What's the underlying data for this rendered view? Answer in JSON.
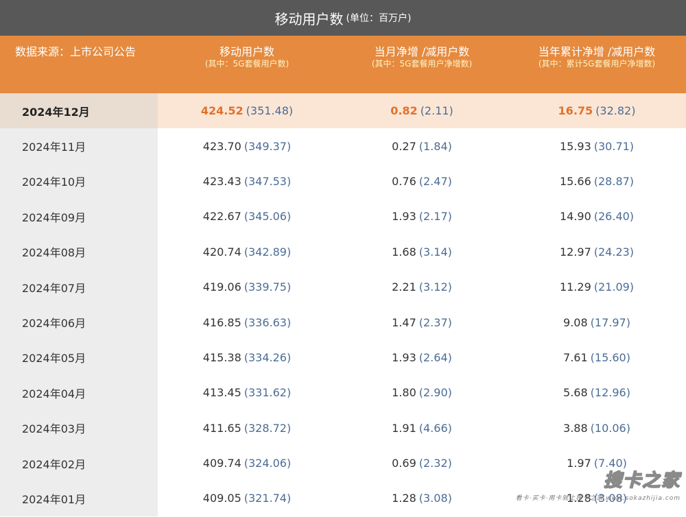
{
  "title": {
    "main": "移动用户数",
    "unit": "(单位：百万户)"
  },
  "header": {
    "source": "数据来源：上市公司公告",
    "col1": {
      "label": "移动用户数",
      "sub": "(其中：5G套餐用户数)"
    },
    "col2": {
      "label": "当月净增 /减用户数",
      "sub": "(其中：5G套餐用户净增数)"
    },
    "col3": {
      "label": "当年累计净增 /减用户数",
      "sub": "(其中：累计5G套餐用户净增数)"
    }
  },
  "rows": [
    {
      "month": "2024年12月",
      "users": "424.52",
      "users_5g": "(351.48)",
      "monthly": "0.82",
      "monthly_5g": "(2.11)",
      "cumulative": "16.75",
      "cumulative_5g": "(32.82)"
    },
    {
      "month": "2024年11月",
      "users": "423.70",
      "users_5g": "(349.37)",
      "monthly": "0.27",
      "monthly_5g": "(1.84)",
      "cumulative": "15.93",
      "cumulative_5g": "(30.71)"
    },
    {
      "month": "2024年10月",
      "users": "423.43",
      "users_5g": "(347.53)",
      "monthly": "0.76",
      "monthly_5g": "(2.47)",
      "cumulative": "15.66",
      "cumulative_5g": "(28.87)"
    },
    {
      "month": "2024年09月",
      "users": "422.67",
      "users_5g": "(345.06)",
      "monthly": "1.93",
      "monthly_5g": "(2.17)",
      "cumulative": "14.90",
      "cumulative_5g": "(26.40)"
    },
    {
      "month": "2024年08月",
      "users": "420.74",
      "users_5g": "(342.89)",
      "monthly": "1.68",
      "monthly_5g": "(3.14)",
      "cumulative": "12.97",
      "cumulative_5g": "(24.23)"
    },
    {
      "month": "2024年07月",
      "users": "419.06",
      "users_5g": "(339.75)",
      "monthly": "2.21",
      "monthly_5g": "(3.12)",
      "cumulative": "11.29",
      "cumulative_5g": "(21.09)"
    },
    {
      "month": "2024年06月",
      "users": "416.85",
      "users_5g": "(336.63)",
      "monthly": "1.47",
      "monthly_5g": "(2.37)",
      "cumulative": "9.08",
      "cumulative_5g": "(17.97)"
    },
    {
      "month": "2024年05月",
      "users": "415.38",
      "users_5g": "(334.26)",
      "monthly": "1.93",
      "monthly_5g": "(2.64)",
      "cumulative": "7.61",
      "cumulative_5g": "(15.60)"
    },
    {
      "month": "2024年04月",
      "users": "413.45",
      "users_5g": "(331.62)",
      "monthly": "1.80",
      "monthly_5g": "(2.90)",
      "cumulative": "5.68",
      "cumulative_5g": "(12.96)"
    },
    {
      "month": "2024年03月",
      "users": "411.65",
      "users_5g": "(328.72)",
      "monthly": "1.91",
      "monthly_5g": "(4.66)",
      "cumulative": "3.88",
      "cumulative_5g": "(10.06)"
    },
    {
      "month": "2024年02月",
      "users": "409.74",
      "users_5g": "(324.06)",
      "monthly": "0.69",
      "monthly_5g": "(2.32)",
      "cumulative": "1.97",
      "cumulative_5g": "(7.40)"
    },
    {
      "month": "2024年01月",
      "users": "409.05",
      "users_5g": "(321.74)",
      "monthly": "1.28",
      "monthly_5g": "(3.08)",
      "cumulative": "1.28",
      "cumulative_5g": "(3.08)"
    }
  ],
  "watermark": {
    "logo": "搜卡之家",
    "tagline": "看卡·买卡·用卡就上搜卡之家 www.sokazhijia.com"
  },
  "colors": {
    "title_bg": "#585858",
    "header_bg": "#e58a3e",
    "highlight": "#e3702b",
    "subvalue": "#4b6c95"
  }
}
